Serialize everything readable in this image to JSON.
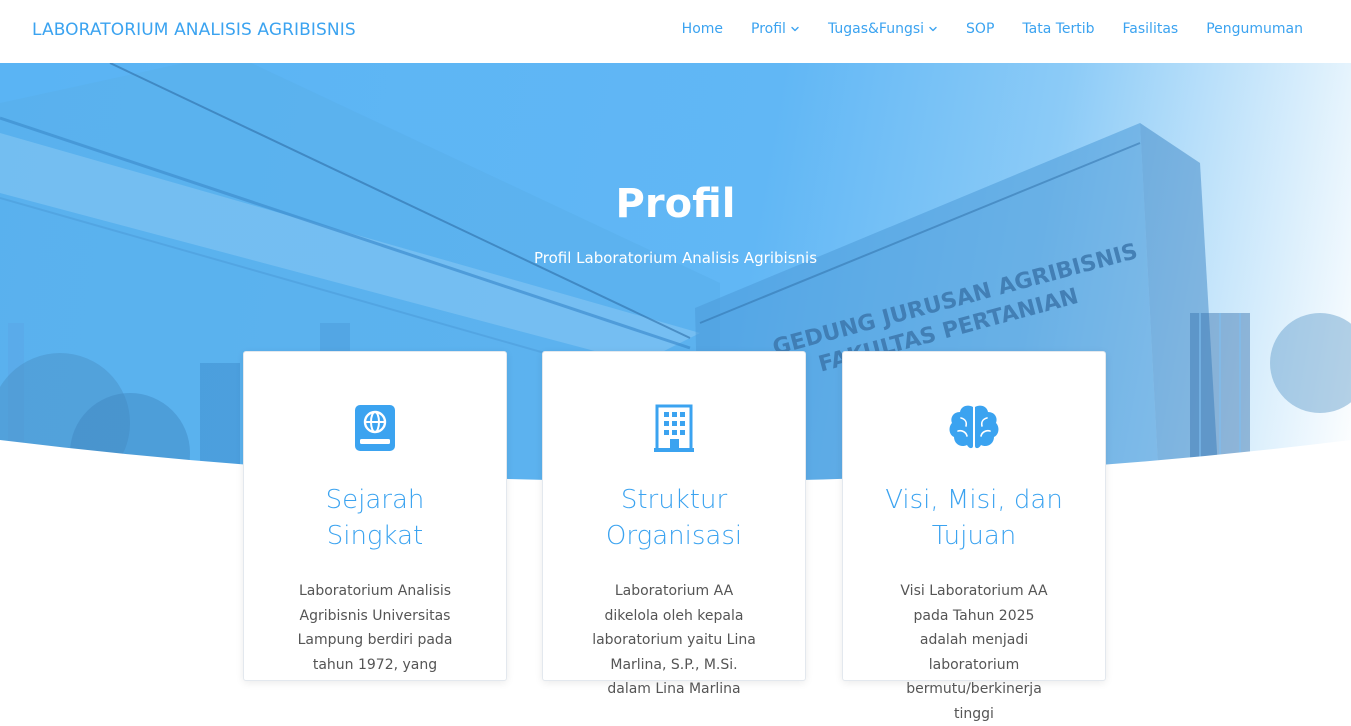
{
  "navbar": {
    "brand": "LABORATORIUM ANALISIS AGRIBISNIS",
    "items": [
      {
        "label": "Home",
        "dropdown": false
      },
      {
        "label": "Profil",
        "dropdown": true
      },
      {
        "label": "Tugas&Fungsi",
        "dropdown": true
      },
      {
        "label": "SOP",
        "dropdown": false
      },
      {
        "label": "Tata Tertib",
        "dropdown": false
      },
      {
        "label": "Fasilitas",
        "dropdown": false
      },
      {
        "label": "Pengumuman",
        "dropdown": false
      }
    ]
  },
  "hero": {
    "title": "Profil",
    "subtitle": "Profil Laboratorium Analisis Agribisnis",
    "sign_line1": "GEDUNG JURUSAN AGRIBISNIS",
    "sign_line2": "FAKULTAS PERTANIAN"
  },
  "cards": [
    {
      "icon": "passport-globe-icon",
      "title": "Sejarah Singkat",
      "text": "Laboratorium Analisis Agribisnis Universitas Lampung berdiri pada tahun 1972, yang"
    },
    {
      "icon": "building-icon",
      "title": "Struktur Organisasi",
      "text": "Laboratorium AA dikelola oleh kepala laboratorium yaitu Lina Marlina, S.P., M.Si. dalam Lina Marlina"
    },
    {
      "icon": "brain-icon",
      "title": "Visi, Misi, dan Tujuan",
      "text": "Visi Laboratorium AA pada Tahun 2025 adalah menjadi laboratorium bermutu/berkinerja tinggi"
    }
  ],
  "colors": {
    "accent": "#3ba3f0",
    "hero_blue": "#61b7f5",
    "text": "#555555"
  }
}
